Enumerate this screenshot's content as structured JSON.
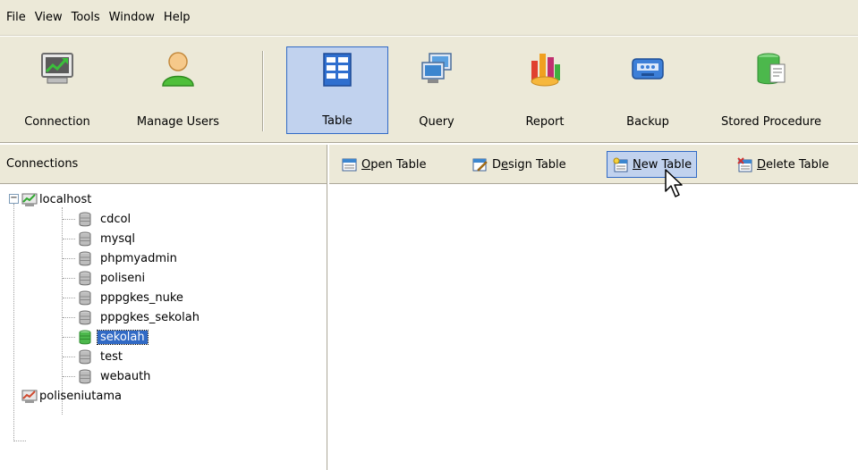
{
  "menu": [
    "File",
    "View",
    "Tools",
    "Window",
    "Help"
  ],
  "toolbar": {
    "connection": "Connection",
    "manage_users": "Manage Users",
    "table": "Table",
    "query": "Query",
    "report": "Report",
    "backup": "Backup",
    "stored_procedure": "Stored Procedure"
  },
  "left_panel": {
    "header": "Connections"
  },
  "tree": {
    "root": "localhost",
    "databases": [
      "cdcol",
      "mysql",
      "phpmyadmin",
      "poliseni",
      "pppgkes_nuke",
      "pppgkes_sekolah",
      "sekolah",
      "test",
      "webauth"
    ],
    "selected": "sekolah",
    "second_root": "poliseniutama"
  },
  "table_toolbar": {
    "open": {
      "first": "O",
      "rest": "pen Table"
    },
    "design": {
      "pre": "D",
      "mid": "e",
      "rest": "sign Table"
    },
    "new": {
      "first": "N",
      "rest": "ew Table"
    },
    "delete": {
      "first": "D",
      "rest": "elete Table"
    }
  },
  "colors": {
    "chrome": "#ece9d8",
    "selection": "#316ac5",
    "highlight": "#c1d2ee"
  }
}
